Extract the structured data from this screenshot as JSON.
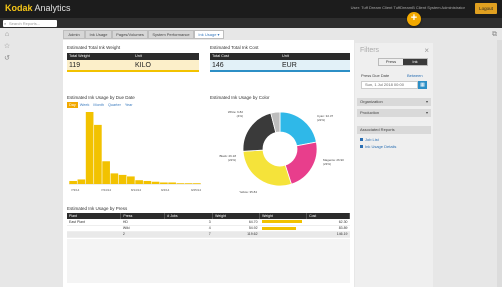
{
  "app": {
    "brand": "Kodak",
    "product": " Analytics"
  },
  "header": {
    "user_info": "User: Tuff Dream Client TuffDreamB Client System Administrator",
    "logout_label": "Logout",
    "search_placeholder": "Search Reports...",
    "add_label": "+"
  },
  "tabs": [
    {
      "label": "Admin"
    },
    {
      "label": "Ink Usage"
    },
    {
      "label": "Pages/Volumes"
    },
    {
      "label": "System Performance"
    },
    {
      "label": "Ink Usage ▾"
    }
  ],
  "weight_section": {
    "title": "Estimated Total Ink Weight",
    "head_total": "Total Weight",
    "head_unit": "Unit",
    "value": "119",
    "unit": "KILO"
  },
  "cost_section": {
    "title": "Estimated Total Ink Cost",
    "head_total": "Total Cost",
    "head_unit": "Unit",
    "value": "146",
    "unit": "EUR"
  },
  "usage_by_date": {
    "title": "Estimated Ink Usage by Due Date",
    "ranges": [
      "Day",
      "Week",
      "Month",
      "Quarter",
      "Year"
    ],
    "active_range": "Day"
  },
  "usage_by_color": {
    "title": "Estimated Ink Usage by Color"
  },
  "chart_data": [
    {
      "type": "bar",
      "title": "Estimated Ink Usage by Due Date",
      "categories": [
        "7/3/14",
        "7/8/14",
        "7/13/14",
        "7/18/14",
        "7/23/14",
        "7/28/14",
        "8/2/14",
        "8/7/14",
        "8/12/14",
        "8/17/14",
        "8/22/14",
        "8/27/14",
        "9/1/14",
        "9/6/14",
        "9/11/14",
        "9/16/14"
      ],
      "values": [
        4,
        6,
        95,
        78,
        30,
        14,
        12,
        10,
        5,
        4,
        3,
        2,
        2,
        1,
        1,
        1
      ],
      "tick_labels": [
        "7/3/14",
        "7/24/14",
        "8/14/14",
        "9/4/14",
        "9/25/14"
      ],
      "color": "#f2c200"
    },
    {
      "type": "pie",
      "title": "Estimated Ink Usage by Color",
      "hole": true,
      "slices": [
        {
          "name": "Cyan",
          "label": "Cyan: 32.37 (22%)",
          "value": 22,
          "color": "#2fb8e8"
        },
        {
          "name": "Magenta",
          "label": "Magenta: 26.90 (23%)",
          "value": 23,
          "color": "#e83e8c"
        },
        {
          "name": "Yellow",
          "label": "Yellow: 35.84 (29%)",
          "value": 29,
          "color": "#f5e33a"
        },
        {
          "name": "Black",
          "label": "Black: 26.18 (22%)",
          "value": 22,
          "color": "#3a3a3a"
        },
        {
          "name": "White",
          "label": "White: 6.82 (4%)",
          "value": 4,
          "color": "#bdbdbd"
        }
      ]
    }
  ],
  "press_table": {
    "title": "Estimated Ink Usage by Press",
    "headers": [
      "Plant",
      "Press",
      "# Jobs",
      "Weight",
      "Weight",
      "Cost"
    ],
    "rows": [
      {
        "plant": "East Plant",
        "press": "HD",
        "jobs": "3",
        "weight": "64.70",
        "weight_fraction": 1.0,
        "cost": "62.30"
      },
      {
        "plant": "",
        "press": "Wiki",
        "jobs": "4",
        "weight": "54.92",
        "weight_fraction": 0.85,
        "cost": "83.89"
      }
    ],
    "total": {
      "press": "2",
      "jobs": "7",
      "weight": "119.62",
      "cost": "146.19"
    }
  },
  "filters": {
    "title": "Filters",
    "close": "×",
    "toggle_a": "Press",
    "toggle_b": "Ink",
    "due_date_label": "Press Due Date",
    "between_link": "Between",
    "date_value": "Sun, 1 Jul 2018 00:00",
    "cal_icon": "▦",
    "organization_label": "Organization",
    "production_label": "Production",
    "associated_label": "Associated Reports",
    "reports": [
      "Job List",
      "Ink Usage Details"
    ]
  }
}
